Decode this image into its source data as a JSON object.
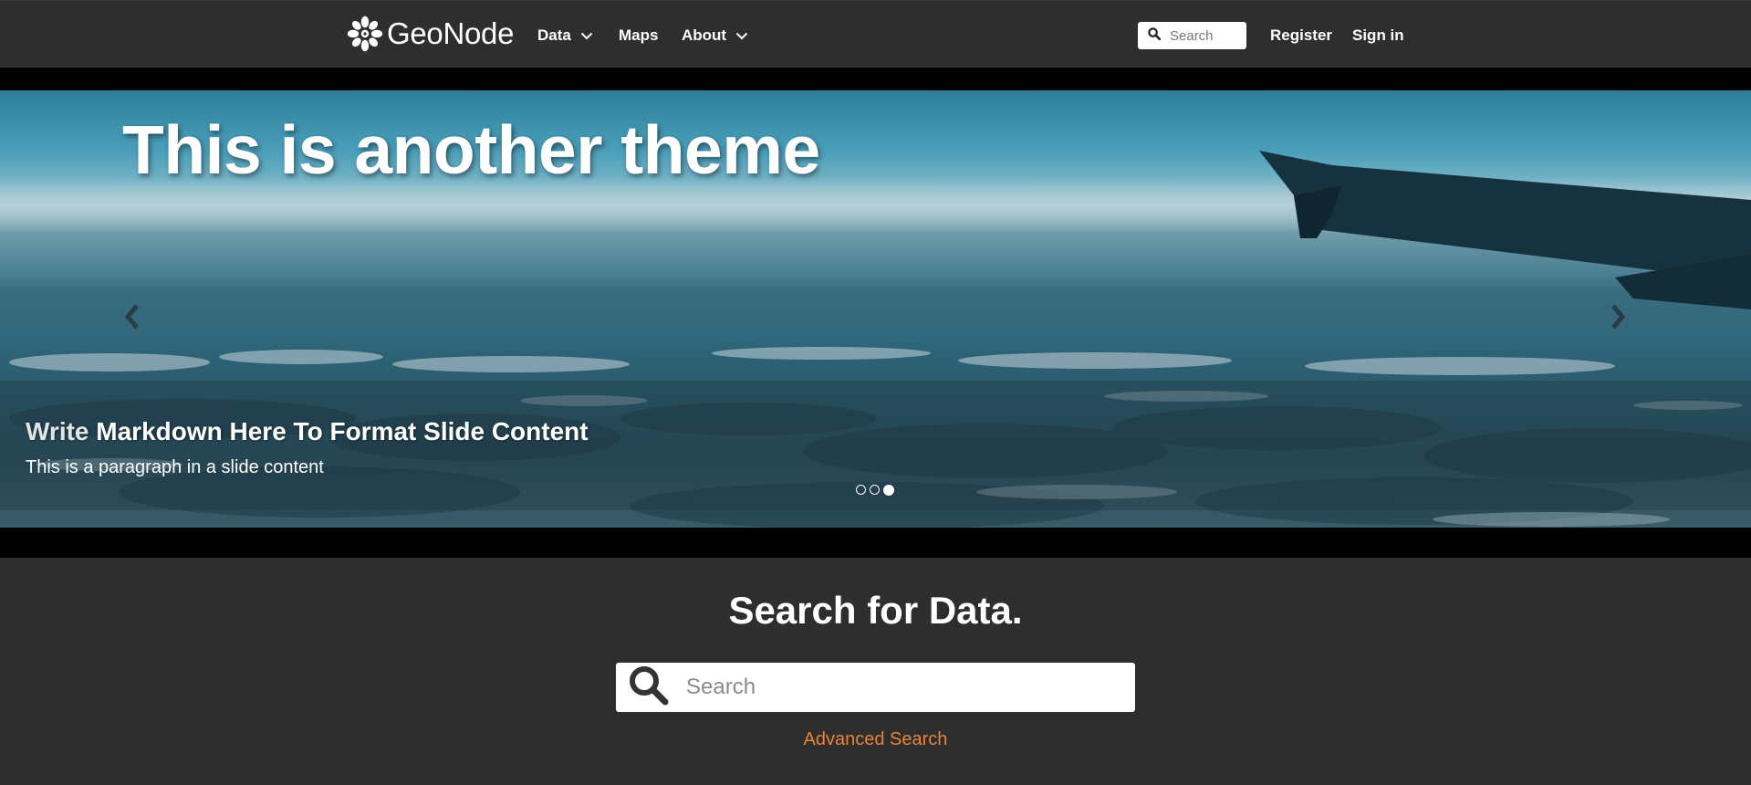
{
  "navbar": {
    "brand": "GeoNode",
    "items": [
      {
        "label": "Data",
        "has_dropdown": true
      },
      {
        "label": "Maps",
        "has_dropdown": false
      },
      {
        "label": "About",
        "has_dropdown": true
      }
    ],
    "search_placeholder": "Search",
    "register_label": "Register",
    "signin_label": "Sign in"
  },
  "hero": {
    "title": "This is another theme",
    "caption_title_soft": "Write",
    "caption_title_rest": " Markdown Here To Format Slide Content",
    "caption_text": "This is a paragraph in a slide content",
    "slide_count": 3,
    "active_slide": 3
  },
  "search_section": {
    "heading": "Search for Data.",
    "search_placeholder": "Search",
    "advanced_link": "Advanced Search"
  },
  "colors": {
    "navbar_bg": "#2e2e2e",
    "page_bg": "#2e2e2e",
    "band_bg": "#000000",
    "link_accent": "#e8833a",
    "text": "#ffffff"
  },
  "icons": {
    "brand": "geonode-logo-icon",
    "dropdown": "chevron-down-icon",
    "search": "search-icon",
    "prev": "chevron-left-icon",
    "next": "chevron-right-icon"
  }
}
